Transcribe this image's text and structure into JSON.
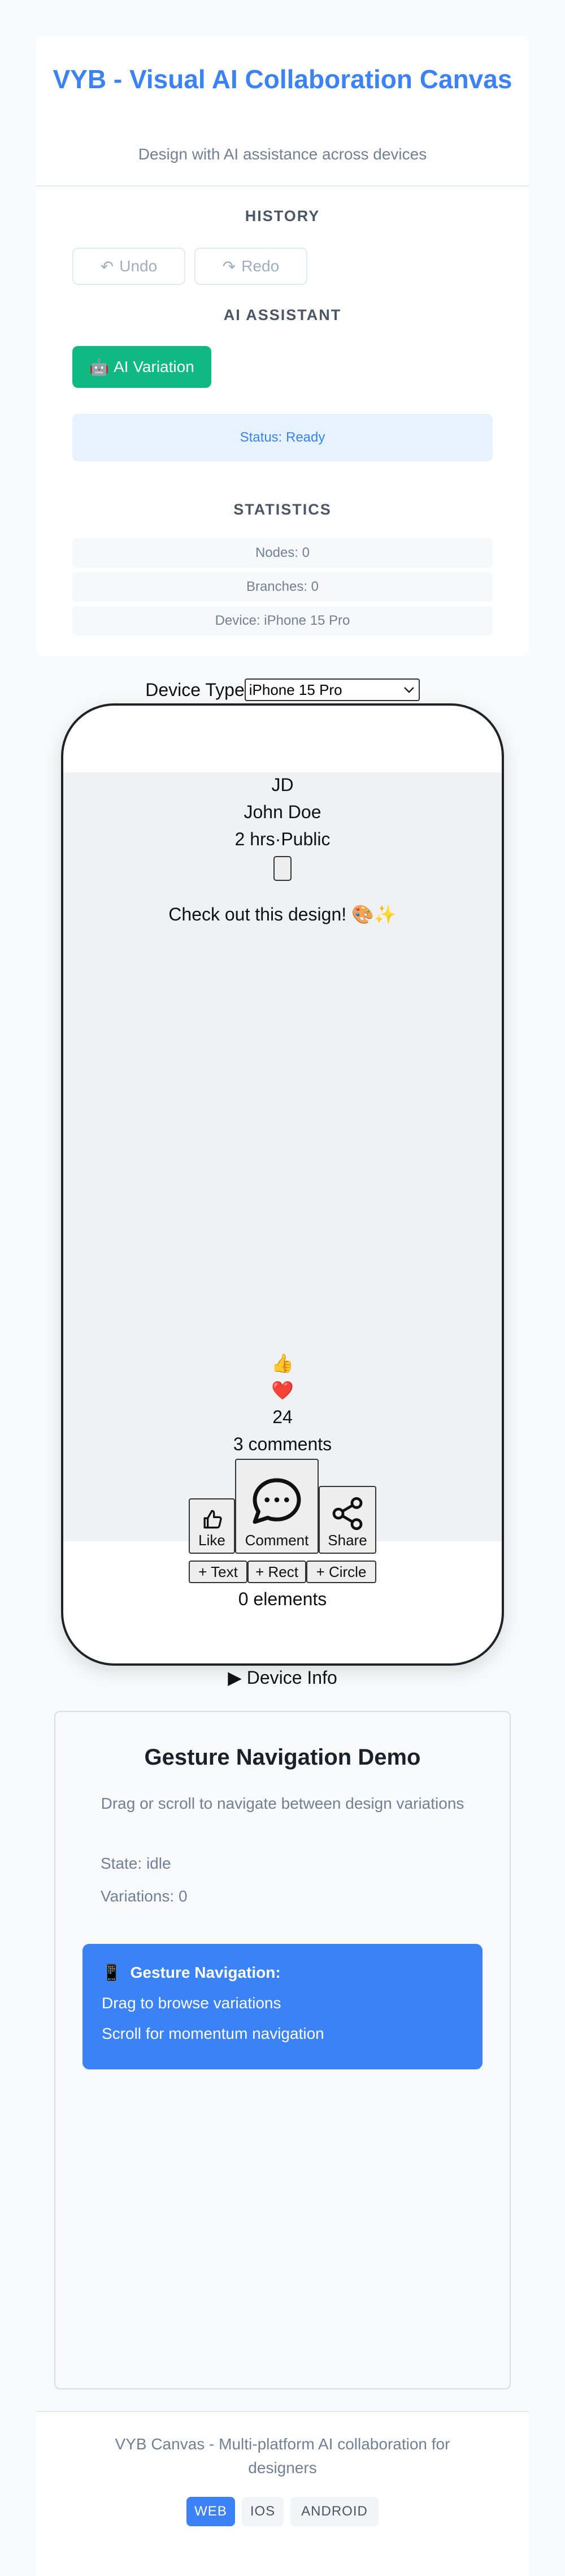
{
  "header": {
    "title": "VYB - Visual AI Collaboration Canvas",
    "subtitle": "Design with AI assistance across devices"
  },
  "history": {
    "title": "HISTORY",
    "undo_icon": "↶",
    "undo_label": "Undo",
    "redo_icon": "↷",
    "redo_label": "Redo"
  },
  "assistant": {
    "title": "AI ASSISTANT",
    "button_icon": "🤖",
    "button_label": "AI Variation",
    "status": "Status: Ready"
  },
  "statistics": {
    "title": "STATISTICS",
    "nodes": "Nodes: 0",
    "branches": "Branches: 0",
    "device": "Device: iPhone 15 Pro"
  },
  "device_picker": {
    "label": "Device Type",
    "selected": "iPhone 15 Pro"
  },
  "post": {
    "avatar_initials": "JD",
    "author": "John Doe",
    "time": "2 hrs",
    "separator": "·",
    "visibility": "Public",
    "text": "Check out this design! 🎨✨",
    "reaction_like": "👍",
    "reaction_love": "❤️",
    "reaction_count": "24",
    "comments": "3 comments",
    "like_label": "Like",
    "comment_label": "Comment",
    "share_label": "Share"
  },
  "canvas_tools": {
    "add_text": "+ Text",
    "add_rect": "+ Rect",
    "add_circle": "+ Circle",
    "element_count": "0 elements"
  },
  "device_info": {
    "label": "Device Info",
    "arrow": "▶"
  },
  "gesture": {
    "title": "Gesture Navigation Demo",
    "subtitle": "Drag or scroll to navigate between design variations",
    "state": "State: idle",
    "variations": "Variations: 0",
    "help_icon": "📱",
    "help_title": "Gesture Navigation:",
    "help_line1": "Drag to browse variations",
    "help_line2": "Scroll for momentum navigation"
  },
  "footer": {
    "text": "VYB Canvas - Multi-platform AI collaboration for designers",
    "platforms": [
      "WEB",
      "IOS",
      "ANDROID"
    ],
    "active_platform": "WEB"
  },
  "colors": {
    "brand": "#3b82f6",
    "ai_button": "#10b981",
    "status_bg": "#e6f2fd"
  }
}
